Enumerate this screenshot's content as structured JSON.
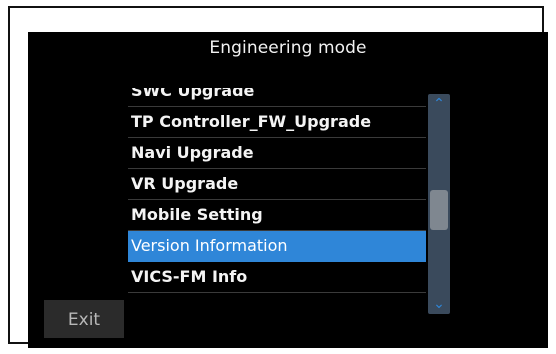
{
  "header": {
    "title": "Engineering mode"
  },
  "menu": {
    "items": [
      {
        "label": "SWC Upgrade",
        "selected": false
      },
      {
        "label": "TP Controller_FW_Upgrade",
        "selected": false
      },
      {
        "label": "Navi Upgrade",
        "selected": false
      },
      {
        "label": "VR Upgrade",
        "selected": false
      },
      {
        "label": "Mobile Setting",
        "selected": false
      },
      {
        "label": "Version Information",
        "selected": true
      },
      {
        "label": "VICS-FM Info",
        "selected": false
      }
    ],
    "scroll_up_icon": "chevron-up-icon",
    "scroll_down_icon": "chevron-down-icon"
  },
  "footer": {
    "exit_label": "Exit"
  },
  "colors": {
    "background": "#000000",
    "selection": "#2f86d8",
    "scrollbar": "#3a4a5c",
    "scroll_thumb": "#7f8790",
    "exit_button": "#2b2b2b"
  }
}
